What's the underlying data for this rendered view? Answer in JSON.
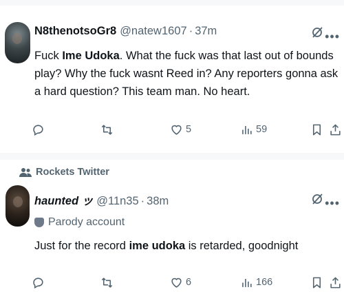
{
  "feed": {
    "tweets": [
      {
        "display_name": "N8thenotsoGr8",
        "handle": "@natew1607",
        "separator": "·",
        "time": "37m",
        "text_parts": [
          {
            "t": "Fuck "
          },
          {
            "t": "Ime Udoka",
            "bold": true
          },
          {
            "t": ". What the fuck was that last out of bounds play? Why the fuck wasnt Reed in? Any reporters gonna ask a hard question? This team man. No heart."
          }
        ],
        "actions": {
          "reply_count": "",
          "retweet_count": "",
          "like_count": "5",
          "view_count": "59"
        }
      },
      {
        "social_context": "Rockets Twitter",
        "display_name": "haunted ッ",
        "handle": "@11n35",
        "separator": "·",
        "time": "38m",
        "parody_label": "Parody account",
        "text_parts": [
          {
            "t": "Just for the record "
          },
          {
            "t": "ime udoka",
            "bold": true
          },
          {
            "t": " is retarded, goodnight"
          }
        ],
        "actions": {
          "reply_count": "",
          "retweet_count": "",
          "like_count": "6",
          "view_count": "166"
        }
      }
    ]
  },
  "icons": {
    "reply": "reply-icon",
    "retweet": "retweet-icon",
    "like": "heart-icon",
    "views": "views-icon",
    "bookmark": "bookmark-icon",
    "share": "share-icon",
    "grok": "grok-icon",
    "more": "more-icon",
    "people": "people-icon",
    "parody": "parody-mask-icon"
  },
  "colors": {
    "text_primary": "#0f1419",
    "text_secondary": "#536471",
    "background": "#f7f8f9",
    "card": "#ffffff"
  }
}
